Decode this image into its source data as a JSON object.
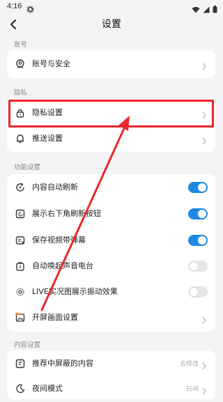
{
  "status_bar": {
    "time": "4:16"
  },
  "nav": {
    "title": "设置"
  },
  "sections": {
    "account": {
      "label": "账号",
      "items": [
        {
          "label": "账号与安全"
        }
      ]
    },
    "privacy": {
      "label": "隐私",
      "items": [
        {
          "label": "隐私设置"
        },
        {
          "label": "推送设置"
        }
      ]
    },
    "features": {
      "label": "功能设置",
      "items": [
        {
          "label": "内容自动刷新",
          "toggle": true
        },
        {
          "label": "展示右下角刷新按钮",
          "toggle": true
        },
        {
          "label": "保存视频带弹幕",
          "toggle": true
        },
        {
          "label": "自动唤起声音电台",
          "toggle": false
        },
        {
          "label": "LIVE实况图展示振动效果",
          "toggle": false
        },
        {
          "label": "开屏画面设置"
        }
      ]
    },
    "content": {
      "label": "内容设置",
      "items": [
        {
          "label": "推荐中屏蔽的内容",
          "value": "去修改"
        },
        {
          "label": "夜间模式",
          "value": "日间"
        }
      ]
    }
  },
  "colors": {
    "accent": "#1e88e5",
    "highlight": "#e8262a"
  },
  "icons": {
    "account": "user-badge-icon",
    "privacy": "lock-icon",
    "push": "bell-icon",
    "refresh": "refresh-icon",
    "refresh_button": "corner-refresh-icon",
    "danmaku": "video-danmaku-icon",
    "radio": "radio-icon",
    "live": "vibration-icon",
    "splash": "image-icon",
    "block": "block-content-icon",
    "night": "moon-icon"
  }
}
